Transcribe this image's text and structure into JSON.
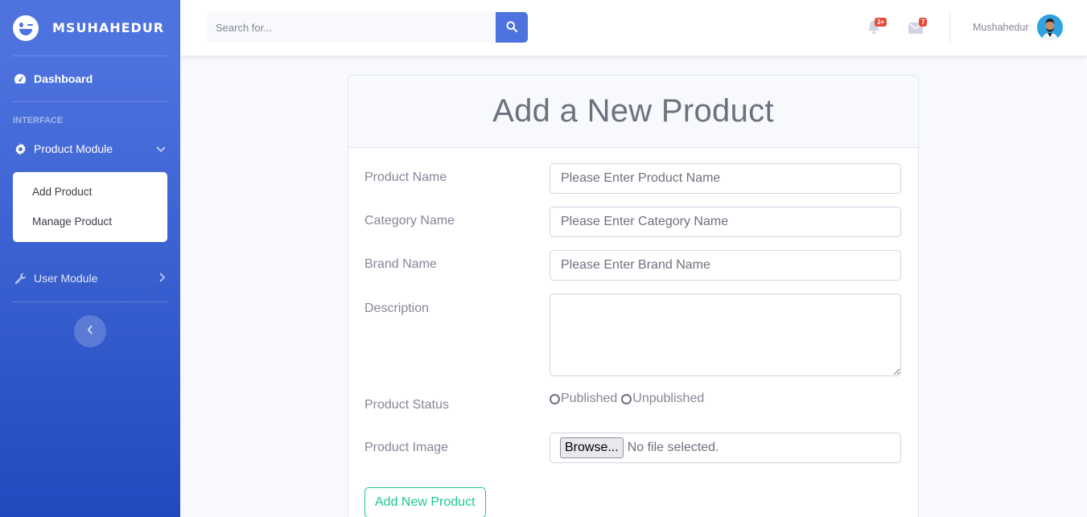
{
  "sidebar": {
    "brand": "MSUHAHEDUR",
    "dashboard": "Dashboard",
    "heading": "INTERFACE",
    "product_module": "Product Module",
    "product_items": [
      "Add Product",
      "Manage Product"
    ],
    "user_module": "User Module"
  },
  "topbar": {
    "search_placeholder": "Search for...",
    "alerts_badge": "3+",
    "messages_badge": "7",
    "username": "Mushahedur"
  },
  "form": {
    "title": "Add a New Product",
    "product_name_label": "Product Name",
    "product_name_placeholder": "Please Enter Product Name",
    "category_label": "Category Name",
    "category_placeholder": "Please Enter Category Name",
    "brand_label": "Brand Name",
    "brand_placeholder": "Please Enter Brand Name",
    "description_label": "Description",
    "status_label": "Product Status",
    "status_options": [
      "Published",
      "Unpublished"
    ],
    "image_label": "Product Image",
    "browse_label": "Browse...",
    "file_status": "No file selected.",
    "submit_label": "Add New Product"
  },
  "colors": {
    "primary": "#4e73df",
    "success": "#1cc88a",
    "danger": "#e74a3b"
  }
}
